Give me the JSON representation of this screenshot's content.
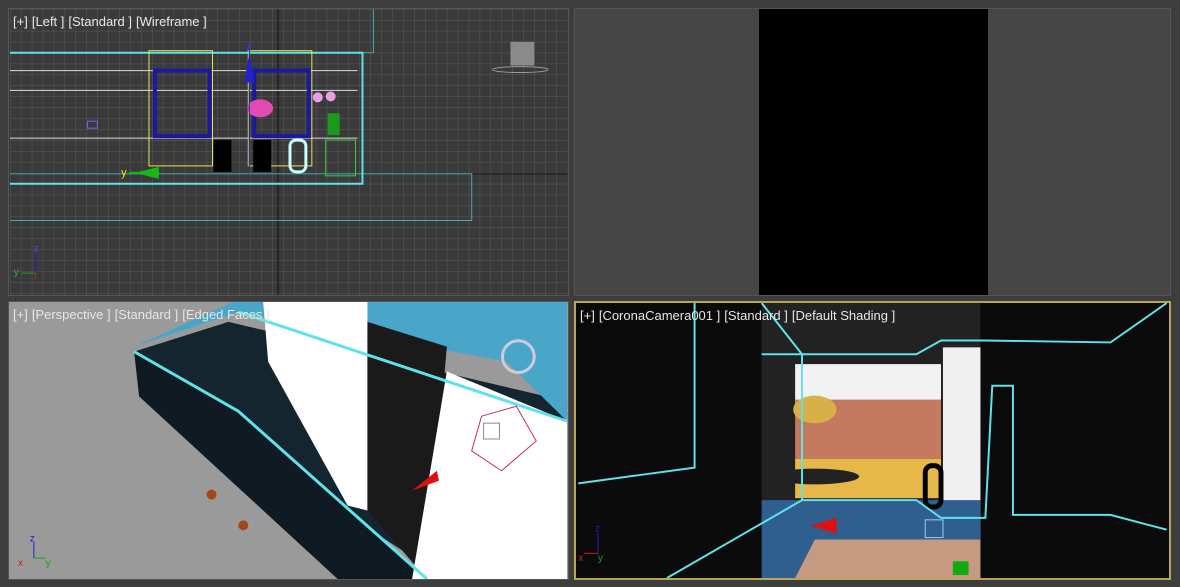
{
  "viewports": [
    {
      "plus": "[+]",
      "view": "[Left ]",
      "shading_preset": "[Standard ]",
      "mode": "[Wireframe ]",
      "viewcube": "LEFT"
    },
    {
      "plus": "",
      "view": "",
      "shading_preset": "",
      "mode": ""
    },
    {
      "plus": "[+]",
      "view": "[Perspective ]",
      "shading_preset": "[Standard ]",
      "mode": "[Edged Faces ]"
    },
    {
      "plus": "[+]",
      "view": "[CoronaCamera001 ]",
      "shading_preset": "[Standard ]",
      "mode": "[Default Shading ]"
    }
  ],
  "axes": {
    "x": "x",
    "y": "y",
    "z": "z"
  },
  "colors": {
    "active_border": "#b9a45a",
    "wire_cyan": "#5fe3e8",
    "grid": "#5a5a5a"
  }
}
